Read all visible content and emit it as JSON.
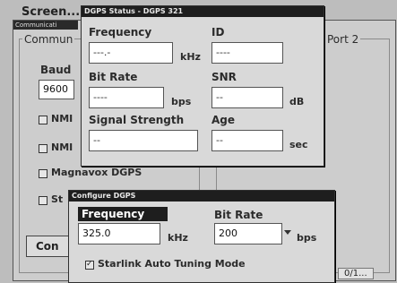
{
  "background_window": {
    "title": "Screen...",
    "inner_title": "Communicati",
    "group_label": "Commun",
    "port2_label": "Port 2",
    "baud_label": "Baud",
    "baud_value": "9600",
    "checks": [
      {
        "label": "NMI"
      },
      {
        "label": "NMI"
      },
      {
        "label": "Magnavox DGPS"
      },
      {
        "label": "St"
      }
    ],
    "button_label": "Con",
    "status_fragment": "0/1..."
  },
  "dgps_status": {
    "title": "DGPS Status - DGPS 321",
    "frequency_label": "Frequency",
    "frequency_value": "---.-",
    "frequency_unit": "kHz",
    "id_label": "ID",
    "id_value": "----",
    "bitrate_label": "Bit Rate",
    "bitrate_value": "----",
    "bitrate_unit": "bps",
    "snr_label": "SNR",
    "snr_value": "--",
    "snr_unit": "dB",
    "signal_label": "Signal Strength",
    "signal_value": "--",
    "age_label": "Age",
    "age_value": "--",
    "age_unit": "sec"
  },
  "configure_dgps": {
    "title": "Configure DGPS",
    "frequency_label": "Frequency",
    "frequency_value": "325.0",
    "frequency_unit": "kHz",
    "bitrate_label": "Bit Rate",
    "bitrate_value": "200",
    "bitrate_unit": "bps",
    "starlink_label": "Starlink Auto Tuning Mode",
    "starlink_checked": true
  }
}
